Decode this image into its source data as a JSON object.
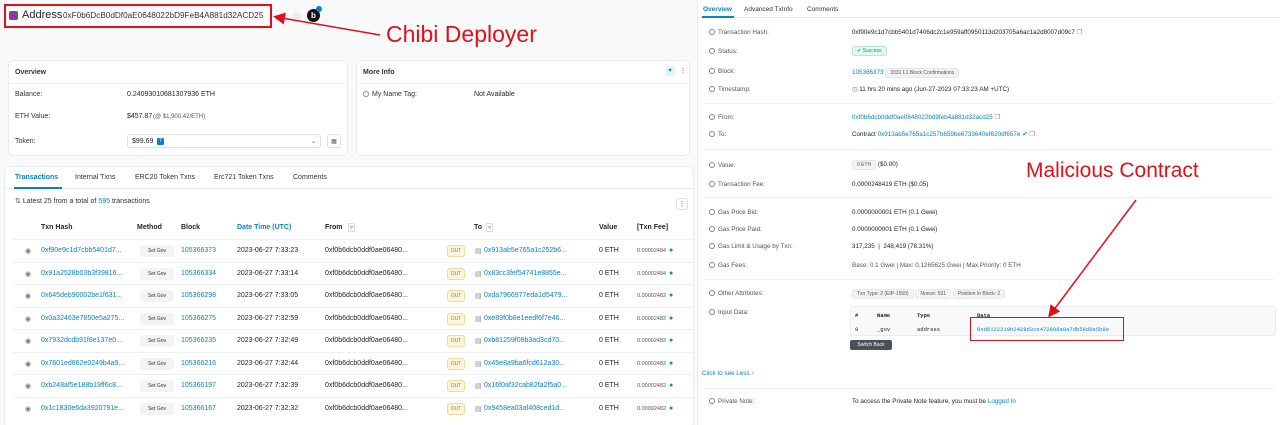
{
  "left": {
    "header": {
      "title": "Address",
      "address": "0xF0b6DcB0dDf0aE0648022bD9FeB4A881d32ACD25"
    },
    "overview": {
      "title": "Overview",
      "balance_label": "Balance:",
      "balance_value": "0.24093010681307936 ETH",
      "eth_value_label": "ETH Value:",
      "eth_value": "$457.87",
      "eth_value_rate": "(@ $1,900.42/ETH)",
      "token_label": "Token:",
      "token_value": "$99.69",
      "token_count": "7"
    },
    "moreinfo": {
      "title": "More Info",
      "name_tag_label": "My Name Tag:",
      "name_tag_value": "Not Available"
    },
    "tabs": [
      "Transactions",
      "Internal Txns",
      "ERC20 Token Txns",
      "Erc721 Token Txns",
      "Comments"
    ],
    "summary": {
      "prefix": "Latest 25 from a total of",
      "count": "595",
      "suffix": "transactions"
    },
    "columns": [
      "Txn Hash",
      "Method",
      "Block",
      "Date Time (UTC)",
      "From",
      "To",
      "Value",
      "[Txn Fee]"
    ],
    "rows": [
      {
        "hash": "0xf90e9c1d7cbb5401d7...",
        "method": "Set Gov",
        "block": "105366373",
        "time": "2023-06-27 7:33:23",
        "from": "0xf0b6dcb0ddf0ae06480...",
        "dir": "OUT",
        "to": "0x913ab5e765a1c252b6...",
        "value": "0 ETH",
        "fee": "0.00002484"
      },
      {
        "hash": "0x91a2528b03b3f39816...",
        "method": "Set Gov",
        "block": "105366334",
        "time": "2023-06-27 7:33:14",
        "from": "0xf0b6dcb0ddf0ae06480...",
        "dir": "OUT",
        "to": "0x83cc3fef54741e8855e...",
        "value": "0 ETH",
        "fee": "0.00002484"
      },
      {
        "hash": "0x645deb90002be1f631...",
        "method": "Set Gov",
        "block": "105366298",
        "time": "2023-06-27 7:33:05",
        "from": "0xf0b6dcb0ddf0ae06480...",
        "dir": "OUT",
        "to": "0xda7966977eda1d5479...",
        "value": "0 ETH",
        "fee": "0.00002482"
      },
      {
        "hash": "0x0a32463e7850e5a275...",
        "method": "Set Gov",
        "block": "105366275",
        "time": "2023-06-27 7:32:59",
        "from": "0xf0b6dcb0ddf0ae06480...",
        "dir": "OUT",
        "to": "0xe89f0b8e1eedf6f7e46...",
        "value": "0 ETH",
        "fee": "0.00002482"
      },
      {
        "hash": "0x7932dcdb91f8e137e0...",
        "method": "Set Gov",
        "block": "105366235",
        "time": "2023-06-27 7:32:49",
        "from": "0xf0b6dcb0ddf0ae06480...",
        "dir": "OUT",
        "to": "0xb81259f08b3ad3cd70...",
        "value": "0 ETH",
        "fee": "0.00002482"
      },
      {
        "hash": "0x7601ed862e0249b4a9...",
        "method": "Set Gov",
        "block": "105366216",
        "time": "2023-06-27 7:32:44",
        "from": "0xf0b6dcb0ddf0ae06480...",
        "dir": "OUT",
        "to": "0x45e8a9ba6fcd612a30...",
        "value": "0 ETH",
        "fee": "0.00002482"
      },
      {
        "hash": "0xb248af5e188b19ff6c8...",
        "method": "Set Gov",
        "block": "105366197",
        "time": "2023-06-27 7:32:39",
        "from": "0xf0b6dcb0ddf0ae06480...",
        "dir": "OUT",
        "to": "0x16f0af32cab82fa2f5a0...",
        "value": "0 ETH",
        "fee": "0.00002482"
      },
      {
        "hash": "0x1c1830e6da3920791e...",
        "method": "Set Gov",
        "block": "105366167",
        "time": "2023-06-27 7:32:32",
        "from": "0xf0b6dcb0ddf0ae06480...",
        "dir": "OUT",
        "to": "0x9458ea03af408ced1d...",
        "value": "0 ETH",
        "fee": "0.00002482"
      }
    ]
  },
  "right": {
    "tabs": [
      "Overview",
      "Advanced TxInfo",
      "Comments"
    ],
    "tx_hash_label": "Transaction Hash:",
    "tx_hash": "0xf90e9c1d7cbb5401d7406dc2c1e959aff0950113d203705a6ac1a2d8007d09c7",
    "status_label": "Status:",
    "status": "Success",
    "block_label": "Block:",
    "block": "105366373",
    "block_conf": "3331 L1 Block Confirmations",
    "timestamp_label": "Timestamp:",
    "timestamp": "11 hrs 20 mins ago (Jun-27-2023 07:33:23 AM +UTC)",
    "from_label": "From:",
    "from": "0xf0b6dcb0ddf0ae0648022bd9feb4a881d32acd25",
    "to_label": "To:",
    "to_prefix": "Contract",
    "to": "0x913ab5e765a1c257b659be6733640ef620df657e",
    "value_label": "Value:",
    "value_eth": "0 ETH",
    "value_usd": "($0.00)",
    "fee_label": "Transaction Fee:",
    "fee": "0.0000248419 ETH ($0.05)",
    "gas_bid_label": "Gas Price Bid:",
    "gas_bid": "0.0000000001 ETH (0.1 Gwei)",
    "gas_paid_label": "Gas Price Paid:",
    "gas_paid": "0.0000000001 ETH (0.1 Gwei)",
    "gas_limit_label": "Gas Limit & Usage by Txn:",
    "gas_limit": "317,235",
    "gas_usage": "248,419 (78.31%)",
    "gas_fees_label": "Gas Fees:",
    "gas_fees": "Base: 0.1 Gwei  |  Max: 0.1265625 Gwei  |  Max Priority: 0 ETH",
    "other_label": "Other Attributes:",
    "attr1": "Txn Type: 2 (EIP-1559)",
    "attr2": "Nonce: 591",
    "attr3": "Position In Block: 2",
    "input_label": "Input Data:",
    "input_cols": [
      "#",
      "Name",
      "Type",
      "Data"
    ],
    "input_row": [
      "0",
      "_gov",
      "address",
      "0xd6122219b2428d3ce472898a0a7db58d0e5b8e"
    ],
    "switch_back": "Switch Back",
    "see_less": "Click to see Less",
    "private_label": "Private Note:",
    "private_text": "To access the Private Note feature, you must be",
    "logged_in": "Logged In"
  },
  "annotations": {
    "deployer": "Chibi Deployer",
    "malicious": "Malicious Contract"
  },
  "colors": {
    "accent": "#0784c3",
    "annot": "#e0101b",
    "success": "#00a186"
  }
}
